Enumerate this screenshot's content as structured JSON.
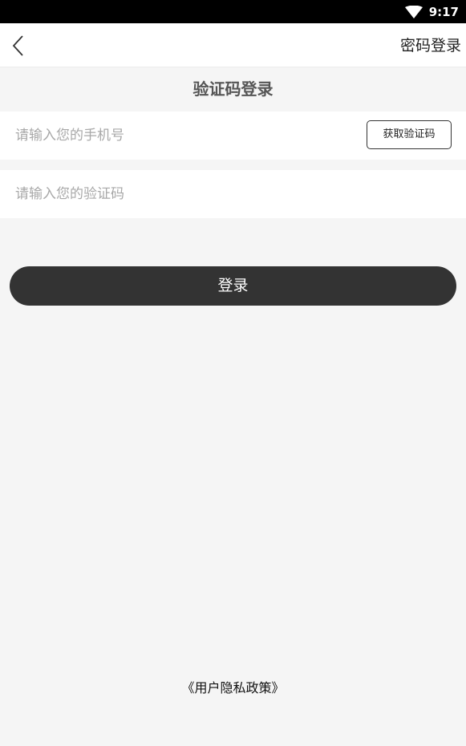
{
  "status_bar": {
    "time": "9:17",
    "wifi_icon": "wifi-icon"
  },
  "app_bar": {
    "back_icon": "chevron-left-icon",
    "right_link": "密码登录"
  },
  "page_title": "验证码登录",
  "phone_field": {
    "placeholder": "请输入您的手机号",
    "value": ""
  },
  "get_code_button": "获取验证码",
  "code_field": {
    "placeholder": "请输入您的验证码",
    "value": ""
  },
  "login_button": "登录",
  "privacy_link": "《用户隐私政策》",
  "colors": {
    "primary_button": "#333333",
    "background": "#f5f5f5",
    "status_bar": "#000000"
  }
}
